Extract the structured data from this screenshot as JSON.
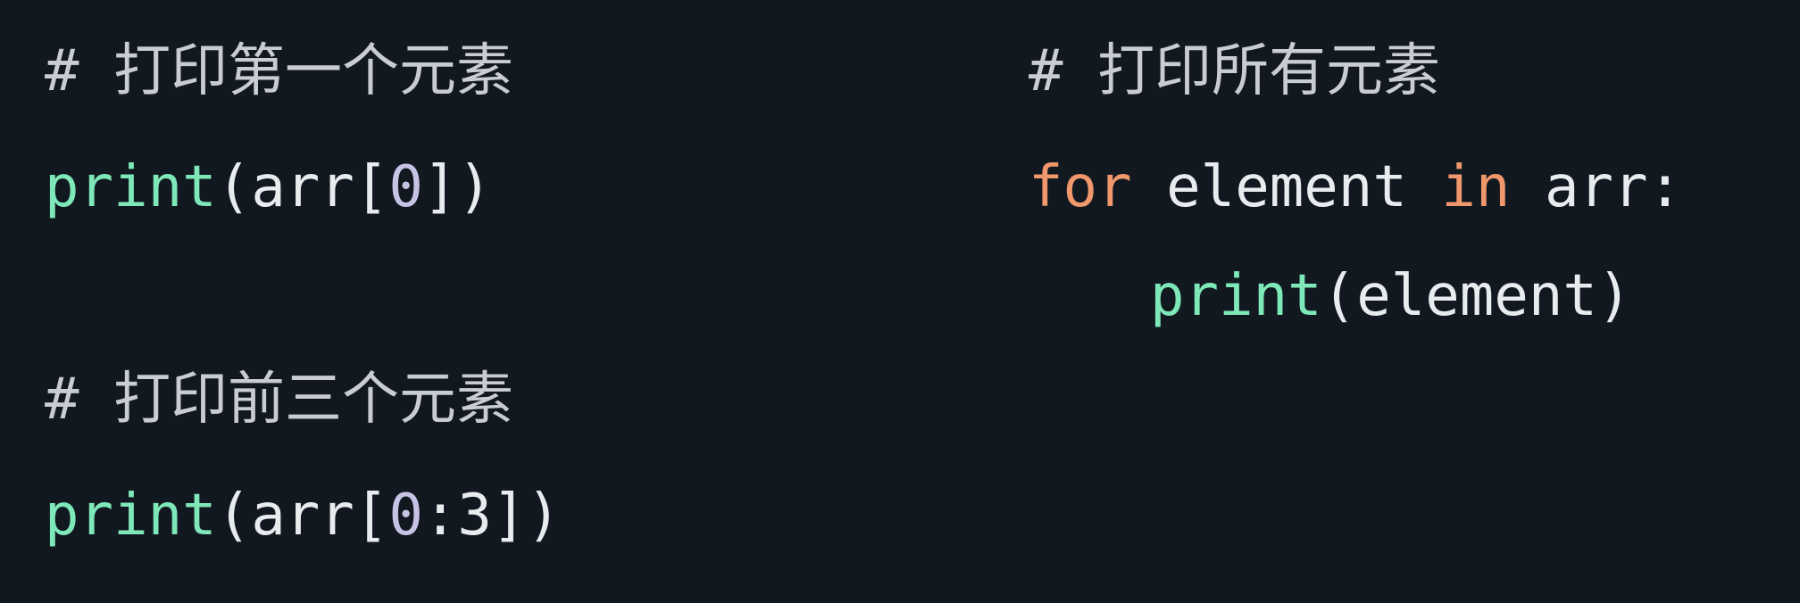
{
  "left": {
    "comment1": "# 打印第一个元素",
    "stmt1": {
      "fn": "print",
      "open": "(arr[",
      "index": "0",
      "close": "])"
    },
    "comment2": "# 打印前三个元素",
    "stmt2": {
      "fn": "print",
      "open": "(arr[",
      "index": "0",
      "sep": ":3",
      "close": "])"
    }
  },
  "right": {
    "comment": "# 打印所有元素",
    "loop": {
      "kw_for": "for",
      "var": " element ",
      "kw_in": "in",
      "iter": " arr:"
    },
    "body": {
      "fn": "print",
      "args": "(element)"
    }
  },
  "colors": {
    "background": "#111820",
    "comment": "#c9ccd1",
    "function": "#7ee8b8",
    "keyword": "#f0976b",
    "text": "#e8ecef"
  }
}
